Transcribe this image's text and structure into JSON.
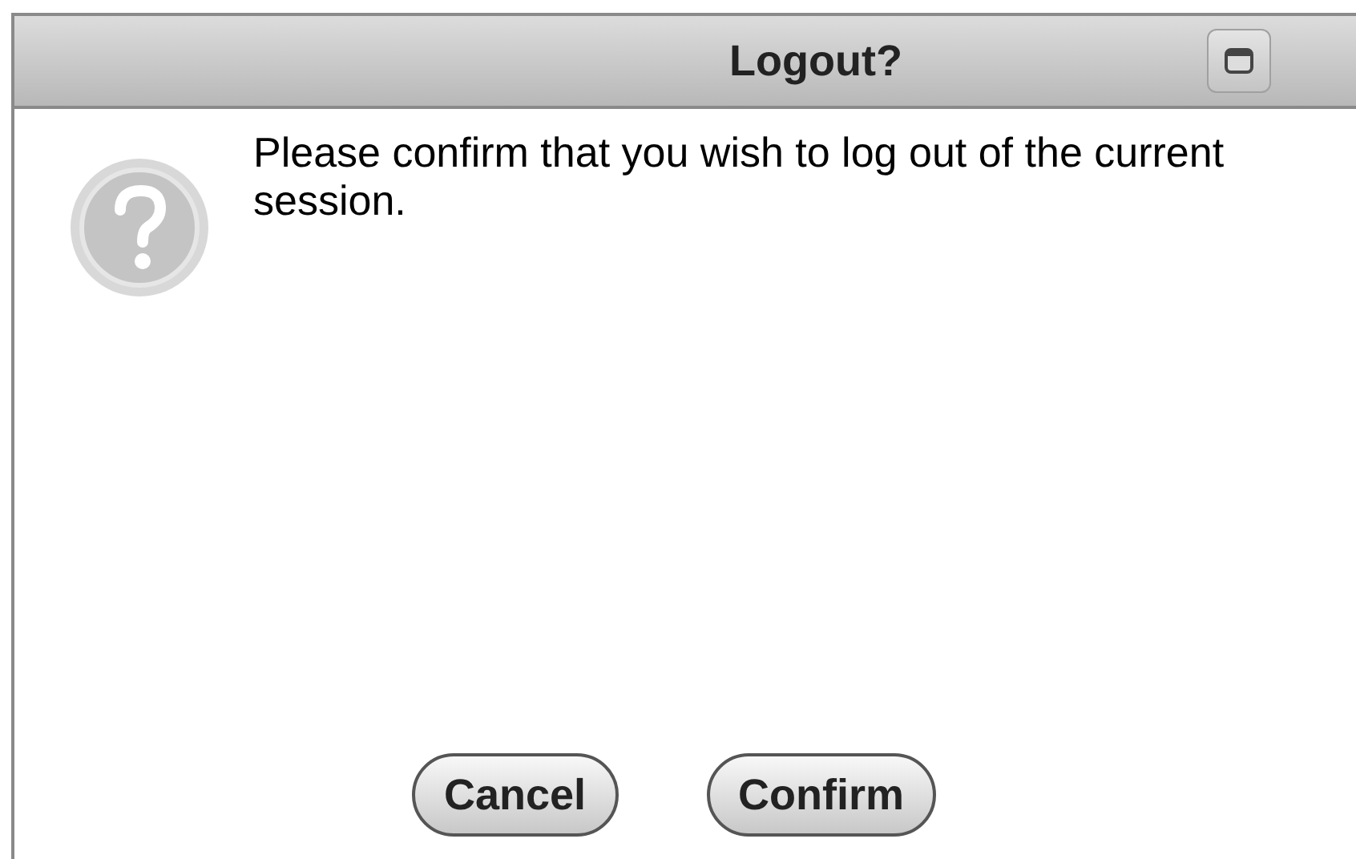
{
  "window": {
    "title": "Logout?"
  },
  "message": "Please confirm that you wish to log out of the current session.",
  "buttons": [
    "Cancel",
    "Confirm"
  ]
}
